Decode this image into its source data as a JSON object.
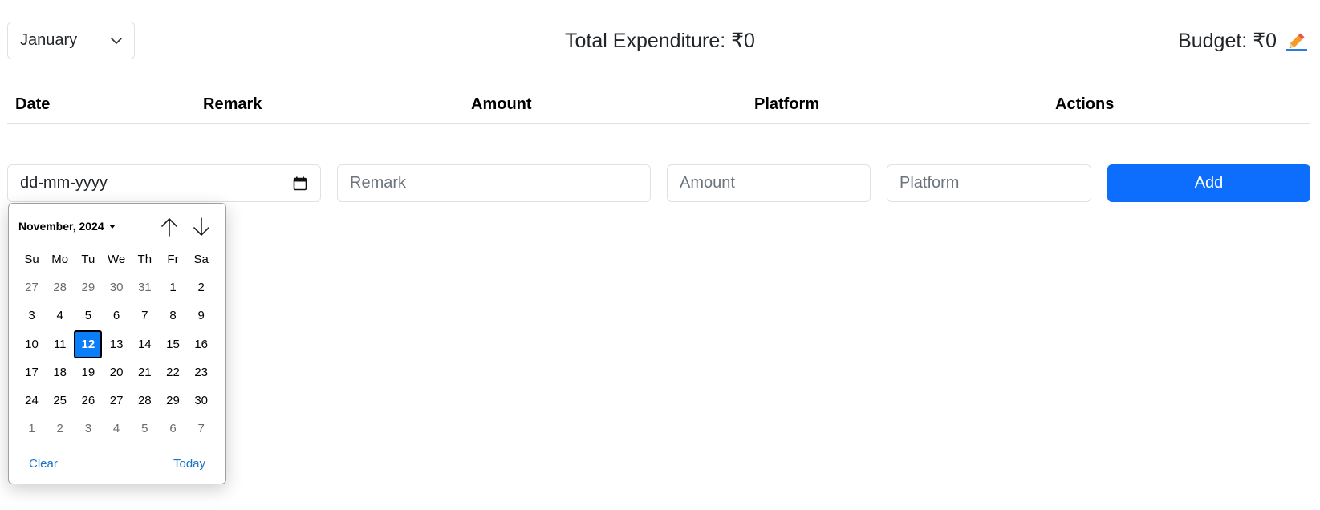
{
  "header": {
    "month_selected": "January",
    "total_label": "Total Expenditure: ₹0",
    "budget_label": "Budget: ₹0",
    "edit_icon": "pencil-icon"
  },
  "table": {
    "headers": [
      "Date",
      "Remark",
      "Amount",
      "Platform",
      "Actions"
    ]
  },
  "form": {
    "date_placeholder": "dd-mm-yyyy",
    "remark_placeholder": "Remark",
    "amount_placeholder": "Amount",
    "platform_placeholder": "Platform",
    "add_label": "Add"
  },
  "datepicker": {
    "month_year": "November, 2024",
    "weekdays": [
      "Su",
      "Mo",
      "Tu",
      "We",
      "Th",
      "Fr",
      "Sa"
    ],
    "weeks": [
      [
        {
          "d": "27",
          "m": true
        },
        {
          "d": "28",
          "m": true
        },
        {
          "d": "29",
          "m": true
        },
        {
          "d": "30",
          "m": true
        },
        {
          "d": "31",
          "m": true
        },
        {
          "d": "1"
        },
        {
          "d": "2"
        }
      ],
      [
        {
          "d": "3"
        },
        {
          "d": "4"
        },
        {
          "d": "5"
        },
        {
          "d": "6"
        },
        {
          "d": "7"
        },
        {
          "d": "8"
        },
        {
          "d": "9"
        }
      ],
      [
        {
          "d": "10"
        },
        {
          "d": "11"
        },
        {
          "d": "12",
          "s": true
        },
        {
          "d": "13"
        },
        {
          "d": "14"
        },
        {
          "d": "15"
        },
        {
          "d": "16"
        }
      ],
      [
        {
          "d": "17"
        },
        {
          "d": "18"
        },
        {
          "d": "19"
        },
        {
          "d": "20"
        },
        {
          "d": "21"
        },
        {
          "d": "22"
        },
        {
          "d": "23"
        }
      ],
      [
        {
          "d": "24"
        },
        {
          "d": "25"
        },
        {
          "d": "26"
        },
        {
          "d": "27"
        },
        {
          "d": "28"
        },
        {
          "d": "29"
        },
        {
          "d": "30"
        }
      ],
      [
        {
          "d": "1",
          "m": true
        },
        {
          "d": "2",
          "m": true
        },
        {
          "d": "3",
          "m": true
        },
        {
          "d": "4",
          "m": true
        },
        {
          "d": "5",
          "m": true
        },
        {
          "d": "6",
          "m": true
        },
        {
          "d": "7",
          "m": true
        }
      ]
    ],
    "clear_label": "Clear",
    "today_label": "Today",
    "selected_color": "#0a7df8"
  },
  "colors": {
    "primary": "#0d6efd",
    "link": "#1a73c8"
  }
}
